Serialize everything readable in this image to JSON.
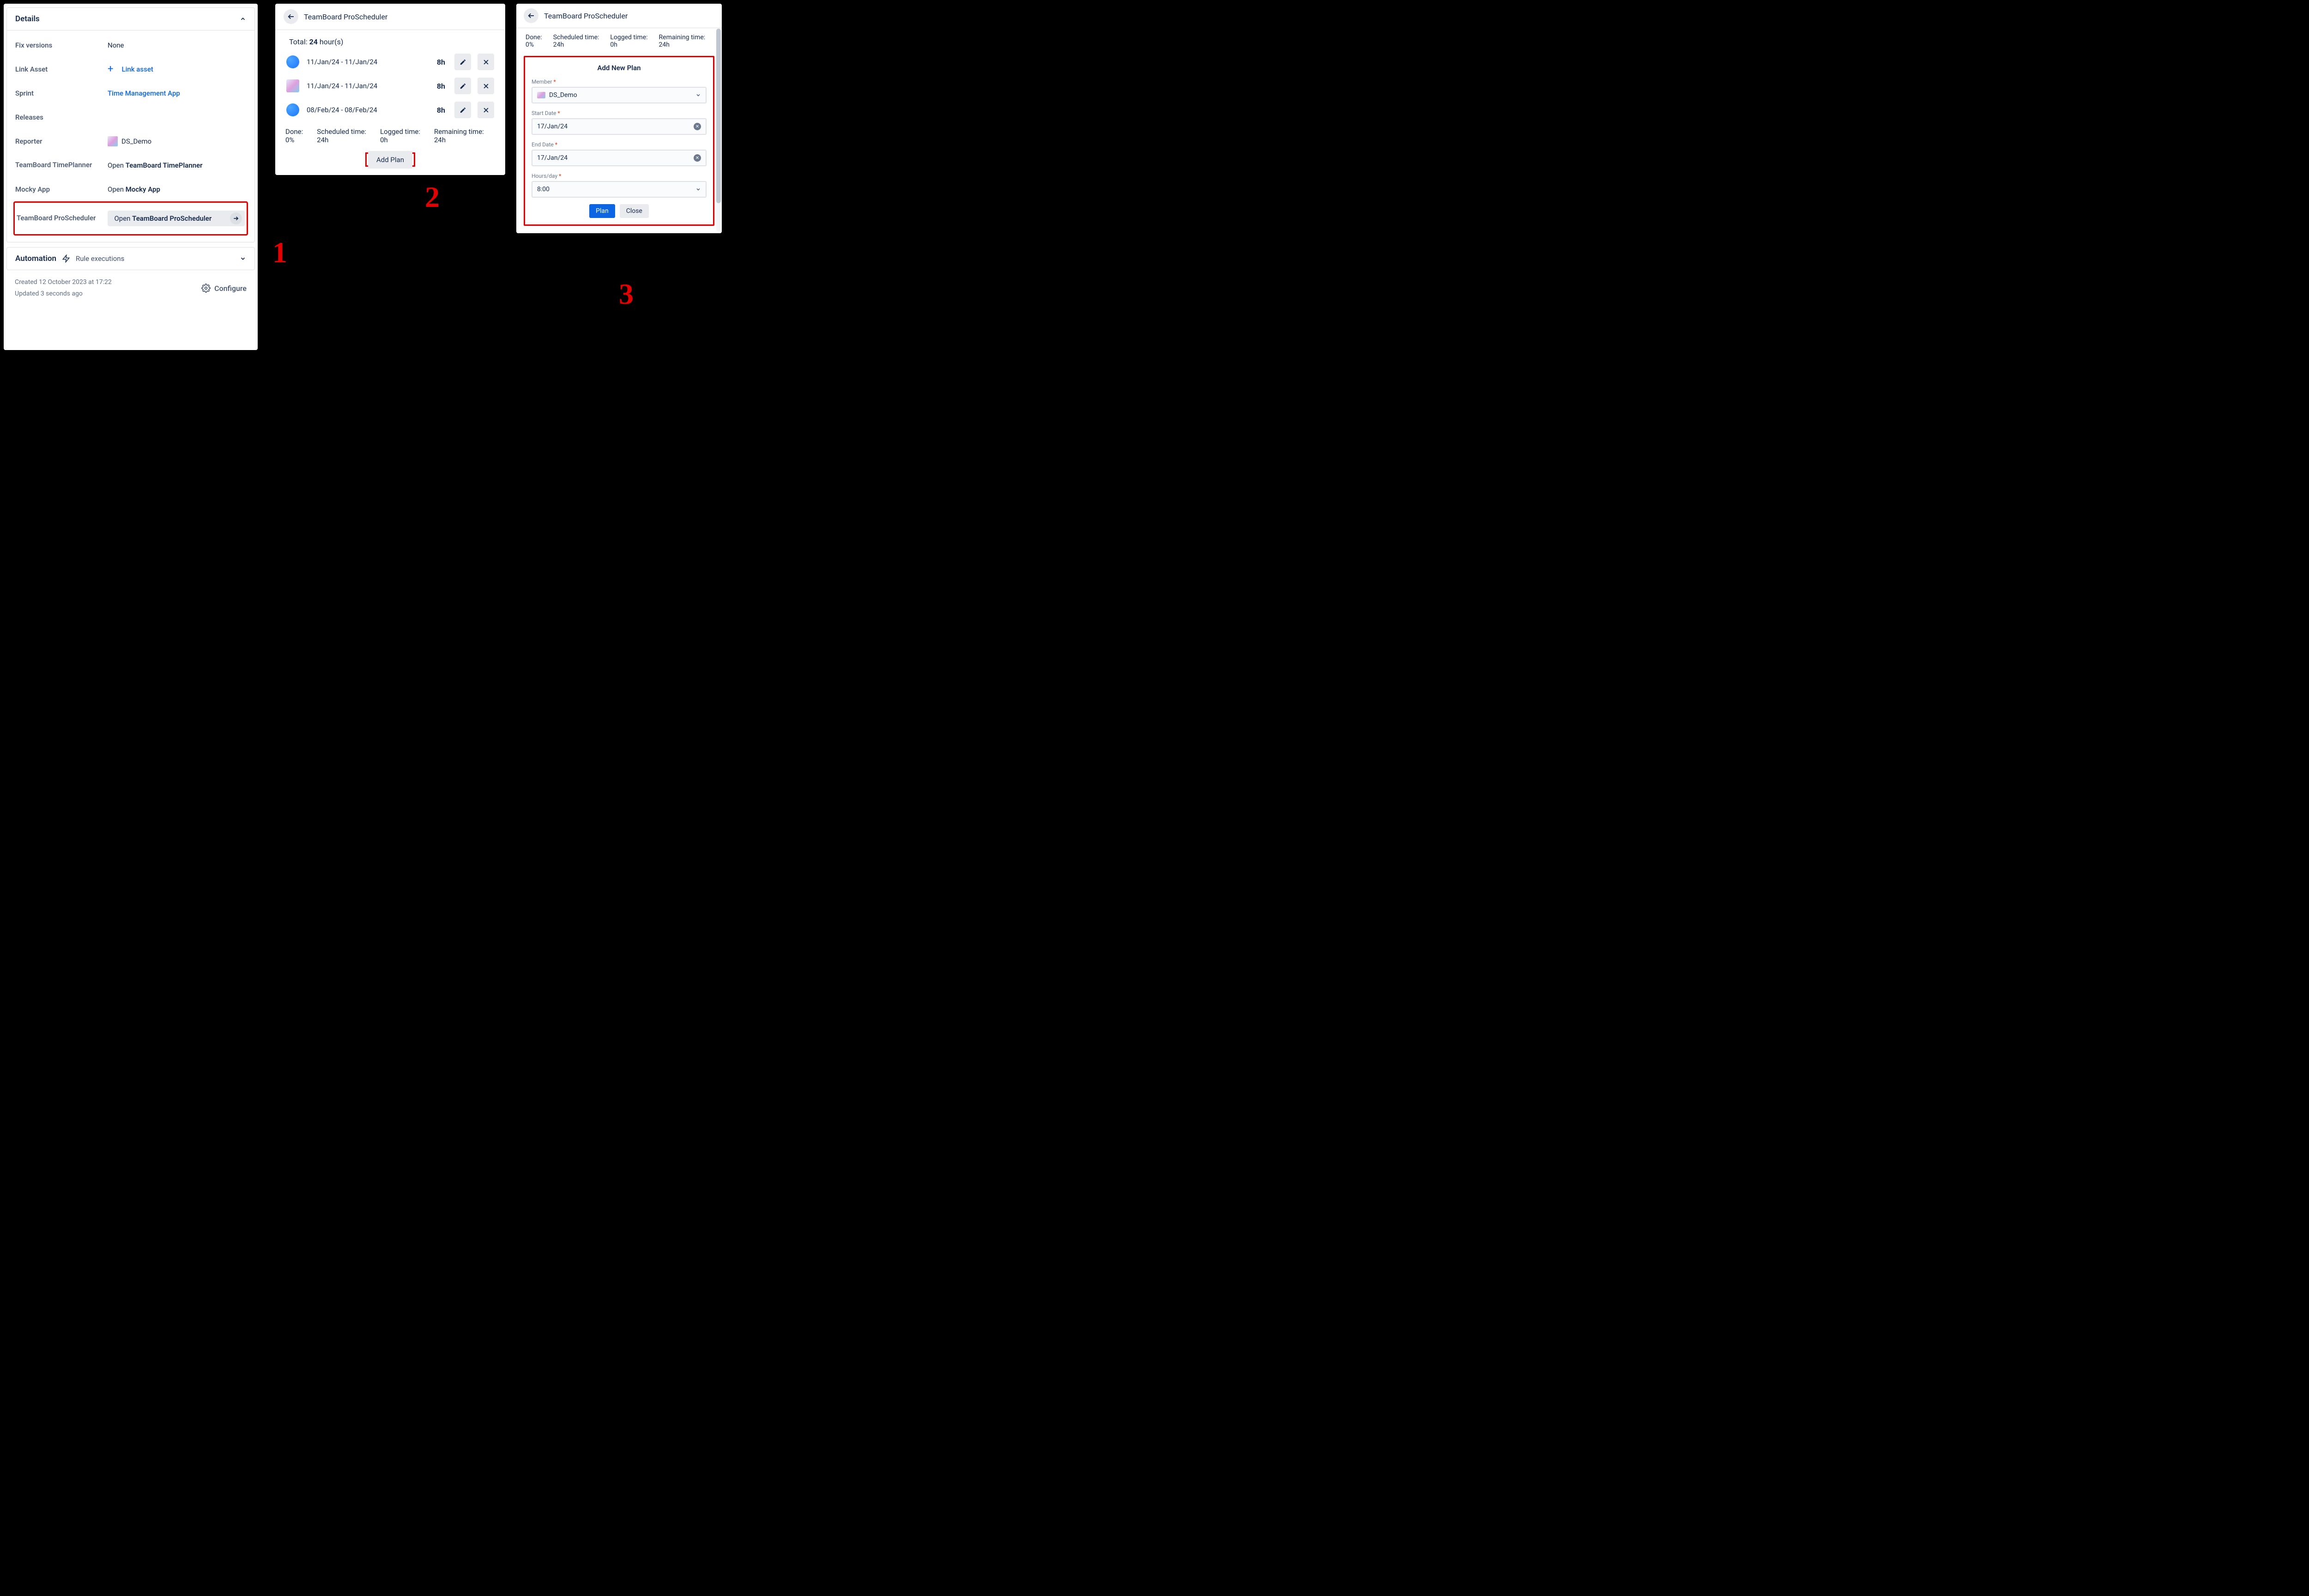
{
  "panel1": {
    "title": "Details",
    "fields": {
      "fix_versions_label": "Fix versions",
      "fix_versions_value": "None",
      "link_asset_label": "Link Asset",
      "link_asset_action": "Link asset",
      "sprint_label": "Sprint",
      "sprint_value": "Time Management App",
      "releases_label": "Releases",
      "reporter_label": "Reporter",
      "reporter_value": "DS_Demo",
      "timeplanner_label": "TeamBoard TimePlanner",
      "timeplanner_open_prefix": "Open ",
      "timeplanner_open_bold": "TeamBoard TimePlanner",
      "mocky_label": "Mocky App",
      "mocky_open_prefix": "Open ",
      "mocky_open_bold": "Mocky App",
      "prosched_label": "TeamBoard ProScheduler",
      "prosched_open_prefix": "Open ",
      "prosched_open_bold": "TeamBoard ProScheduler"
    },
    "automation": {
      "title": "Automation",
      "rule_exec": "Rule executions"
    },
    "meta": {
      "created": "Created 12 October 2023 at 17:22",
      "updated": "Updated 3 seconds ago",
      "configure": "Configure"
    }
  },
  "panel2": {
    "title": "TeamBoard ProScheduler",
    "total_prefix": "Total: ",
    "total_value": "24",
    "total_suffix": " hour(s)",
    "plans": [
      {
        "dates": "11/Jan/24 - 11/Jan/24",
        "hours": "8h",
        "avatar": "a1"
      },
      {
        "dates": "11/Jan/24 - 11/Jan/24",
        "hours": "8h",
        "avatar": "a2"
      },
      {
        "dates": "08/Feb/24 - 08/Feb/24",
        "hours": "8h",
        "avatar": "a1"
      }
    ],
    "stats": {
      "done_lbl": "Done:",
      "done_val": "0%",
      "sched_lbl": "Scheduled time:",
      "sched_val": "24h",
      "logged_lbl": "Logged time:",
      "logged_val": "0h",
      "remain_lbl": "Remaining time:",
      "remain_val": "24h"
    },
    "add_plan": "Add Plan"
  },
  "panel3": {
    "title": "TeamBoard ProScheduler",
    "stats": {
      "done_lbl": "Done:",
      "done_val": "0%",
      "sched_lbl": "Scheduled time:",
      "sched_val": "24h",
      "logged_lbl": "Logged time:",
      "logged_val": "0h",
      "remain_lbl": "Remaining time:",
      "remain_val": "24h"
    },
    "form": {
      "title": "Add New Plan",
      "member_lbl": "Member",
      "member_val": "DS_Demo",
      "start_lbl": "Start Date",
      "start_val": "17/Jan/24",
      "end_lbl": "End Date",
      "end_val": "17/Jan/24",
      "hours_lbl": "Hours/day",
      "hours_val": "8:00",
      "plan_btn": "Plan",
      "close_btn": "Close"
    }
  },
  "annotations": {
    "n1": "1",
    "n2": "2",
    "n3": "3"
  }
}
